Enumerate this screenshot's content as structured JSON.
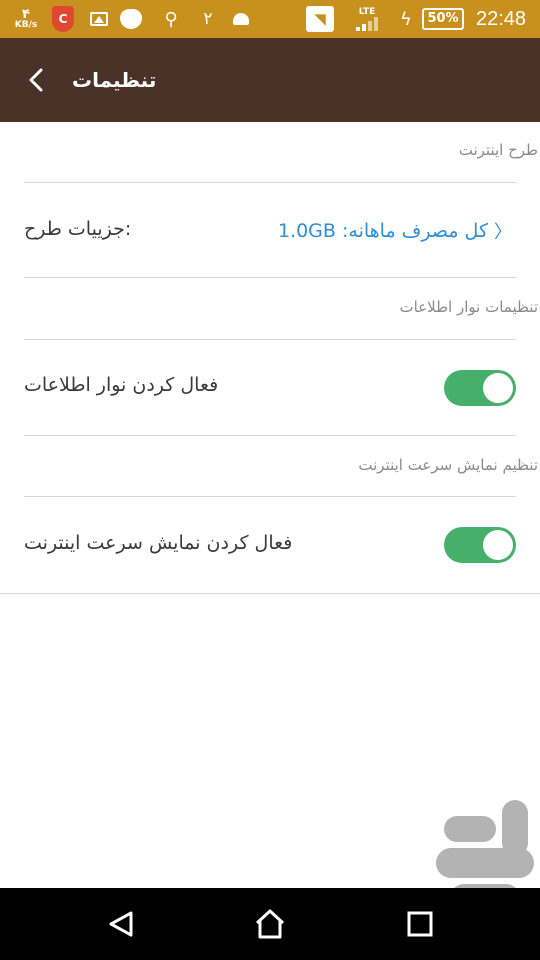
{
  "status_bar": {
    "net_speed_value": "۴",
    "net_speed_unit": "KB/s",
    "app_badge": "C",
    "notification_count": "۲",
    "network_type": "LTE",
    "battery_percent": "50%",
    "time": "22:48",
    "background_color": "#c8901c"
  },
  "app_bar": {
    "title": "تنظیمات",
    "background_color": "#4a3228"
  },
  "sections": {
    "internet_plan": {
      "header": "طرح اینترنت",
      "plan_details_label": "جزییات طرح:",
      "monthly_usage": "کل مصرف ماهانه: 1.0GB"
    },
    "notification_bar": {
      "header": "تنظیمات نوار اطلاعات",
      "toggle_label": "فعال کردن نوار اطلاعات",
      "toggle_on": true
    },
    "speed_display": {
      "header": "تنظیم نمایش سرعت اینترنت",
      "toggle_label": "فعال کردن نمایش سرعت اینترنت",
      "toggle_on": true
    }
  },
  "colors": {
    "accent_link": "#2f8ed6",
    "toggle_on": "#46b06a"
  },
  "icons": {
    "back": "chevron-left-icon",
    "nav_back": "triangle-back-icon",
    "nav_home": "house-icon",
    "nav_recents": "square-recents-icon",
    "watermark": "store-logo"
  }
}
